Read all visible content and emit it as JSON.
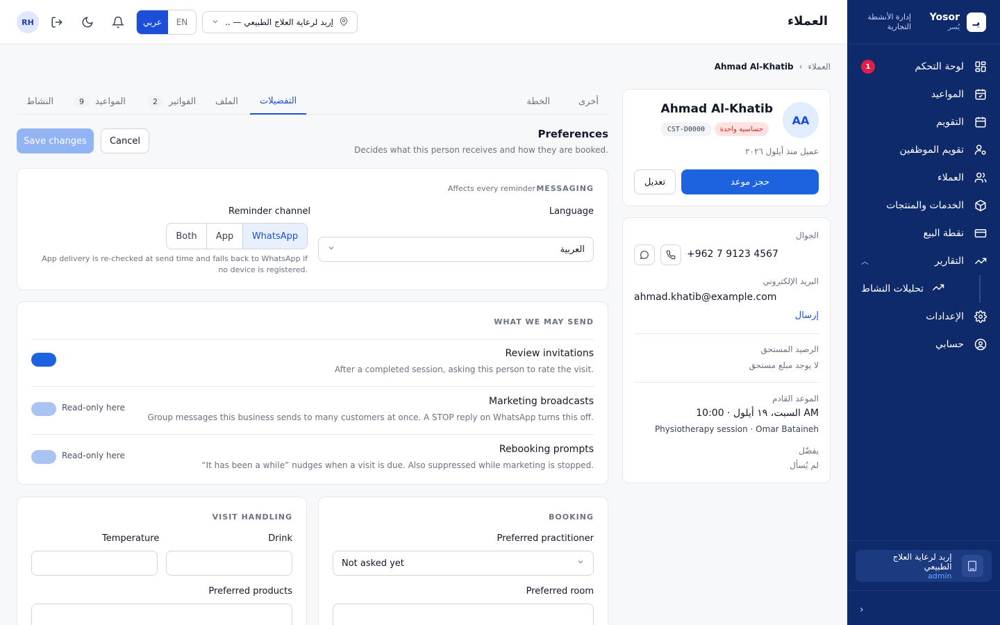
{
  "sidebar": {
    "brand_en": "Yosor",
    "brand_ar": "يُسر",
    "brand_logo": "يـ",
    "brand_subtitle": "إدارة الأنشطة التجارية",
    "items": [
      {
        "label": "لوحة التحكم",
        "icon": "dashboard-icon",
        "badge": "1"
      },
      {
        "label": "المواعيد",
        "icon": "calendar-check-icon"
      },
      {
        "label": "التقويم",
        "icon": "calendar-icon"
      },
      {
        "label": "تقويم الموظفين",
        "icon": "user-cog-icon"
      },
      {
        "label": "العملاء",
        "icon": "users-icon"
      },
      {
        "label": "الخدمات والمنتجات",
        "icon": "box-icon"
      },
      {
        "label": "نقطة البيع",
        "icon": "credit-card-icon"
      },
      {
        "label": "التقارير",
        "icon": "trend-icon"
      }
    ],
    "sub_items": [
      {
        "label": "تحليلات النشاط",
        "icon": "trend-icon"
      }
    ],
    "bottom_items": [
      {
        "label": "الإعدادات",
        "icon": "gear-icon"
      },
      {
        "label": "حسابي",
        "icon": "user-circle-icon"
      }
    ],
    "org": {
      "name": "إربد لرعاية العلاج الطبيعي",
      "role": "admin"
    }
  },
  "topbar": {
    "title": "العملاء",
    "avatar": "RH",
    "lang_active": "عربي",
    "lang_other": "EN",
    "location": "إربد لرعاية العلاج الطبيعي — ..."
  },
  "breadcrumb": {
    "parent": "العملاء",
    "current": "Ahmad Al-Khatib"
  },
  "profile": {
    "initials": "AA",
    "name": "Ahmad Al-Khatib",
    "tag_sensitivity": "حساسية واحدة",
    "customer_id": "CST-D0000",
    "since": "عميل منذ أيلول ٢٠٢٦",
    "book_button": "حجز موعد",
    "edit_button": "تعديل"
  },
  "contact": {
    "phone_label": "الجوال",
    "phone": "+962 7 9123 4567",
    "email_label": "البريد الإلكتروني",
    "email": "ahmad.khatib@example.com",
    "send_link": "إرسال",
    "balance_label": "الرصيد المستحق",
    "balance_value": "لا يوجد مبلغ مستحق",
    "next_label": "الموعد القادم",
    "next_date": "السبت، ١٩ أيلول · 10:00 AM",
    "next_detail": "Physiotherapy session · Omar Bataineh",
    "prefers_label": "يفضّل",
    "prefers_value": "لم يُسأل"
  },
  "tabs": [
    {
      "label": "أخرى",
      "count": ""
    },
    {
      "label": "الخطة",
      "count": ""
    },
    {
      "label": "التفضيلات",
      "count": "",
      "active": true
    },
    {
      "label": "الملف",
      "count": ""
    },
    {
      "label": "الفواتير",
      "count": "2"
    },
    {
      "label": "المواعيد",
      "count": "9"
    },
    {
      "label": "النشاط",
      "count": ""
    }
  ],
  "preferences": {
    "title": "Preferences",
    "subtitle": "Decides what this person receives and how they are booked.",
    "save": "Save changes",
    "cancel": "Cancel"
  },
  "messaging": {
    "heading": "MESSAGING",
    "note": "Affects every reminder",
    "language_label": "Language",
    "language_value": "العربية",
    "reminder_label": "Reminder channel",
    "channels": [
      "Both",
      "App",
      "WhatsApp"
    ],
    "selected_channel": "WhatsApp",
    "hint": "App delivery is re-checked at send time and falls back to WhatsApp if no device is registered."
  },
  "send": {
    "heading": "WHAT WE MAY SEND",
    "rows": [
      {
        "title": "Review invitations",
        "desc": "After a completed session, asking this person to rate the visit.",
        "state": "on",
        "note": ""
      },
      {
        "title": "Marketing broadcasts",
        "desc": "Group messages this business sends to many customers at once. A STOP reply on WhatsApp turns this off.",
        "state": "read-only",
        "note": "Read-only here"
      },
      {
        "title": "Rebooking prompts",
        "desc": "“It has been a while” nudges when a visit is due. Also suppressed while marketing is stopped.",
        "state": "read-only",
        "note": "Read-only here"
      }
    ]
  },
  "booking": {
    "heading": "BOOKING",
    "practitioner_label": "Preferred practitioner",
    "practitioner_value": "Not asked yet",
    "room_label": "Preferred room"
  },
  "visit": {
    "heading": "VISIT HANDLING",
    "drink_label": "Drink",
    "temperature_label": "Temperature",
    "products_label": "Preferred products"
  },
  "colors": {
    "sidebar": "#0f2a6b",
    "accent": "#1d63e0",
    "danger": "#dc2626"
  }
}
